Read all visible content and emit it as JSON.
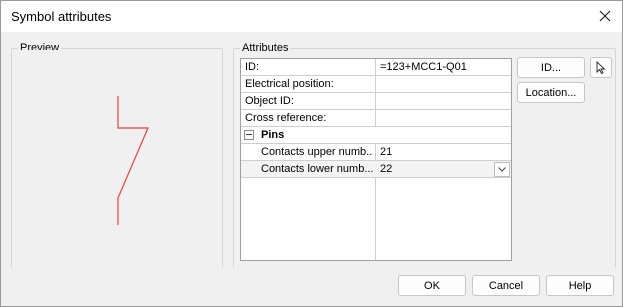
{
  "window": {
    "title": "Symbol attributes"
  },
  "preview": {
    "label": "Preview"
  },
  "attributes": {
    "label": "Attributes",
    "rows": [
      {
        "label": "ID:",
        "value": "=123+MCC1-Q01"
      },
      {
        "label": "Electrical position:",
        "value": ""
      },
      {
        "label": "Object ID:",
        "value": ""
      },
      {
        "label": "Cross reference:",
        "value": ""
      }
    ],
    "category": {
      "label": "Pins",
      "expanded": true
    },
    "pin_rows": [
      {
        "label": "Contacts upper numb...",
        "value": "21"
      },
      {
        "label": "Contacts lower numb...",
        "value": "22"
      }
    ]
  },
  "side_buttons": {
    "id": "ID...",
    "location": "Location..."
  },
  "footer": {
    "ok": "OK",
    "cancel": "Cancel",
    "help": "Help"
  },
  "colors": {
    "symbol_line": "#e8413a"
  }
}
